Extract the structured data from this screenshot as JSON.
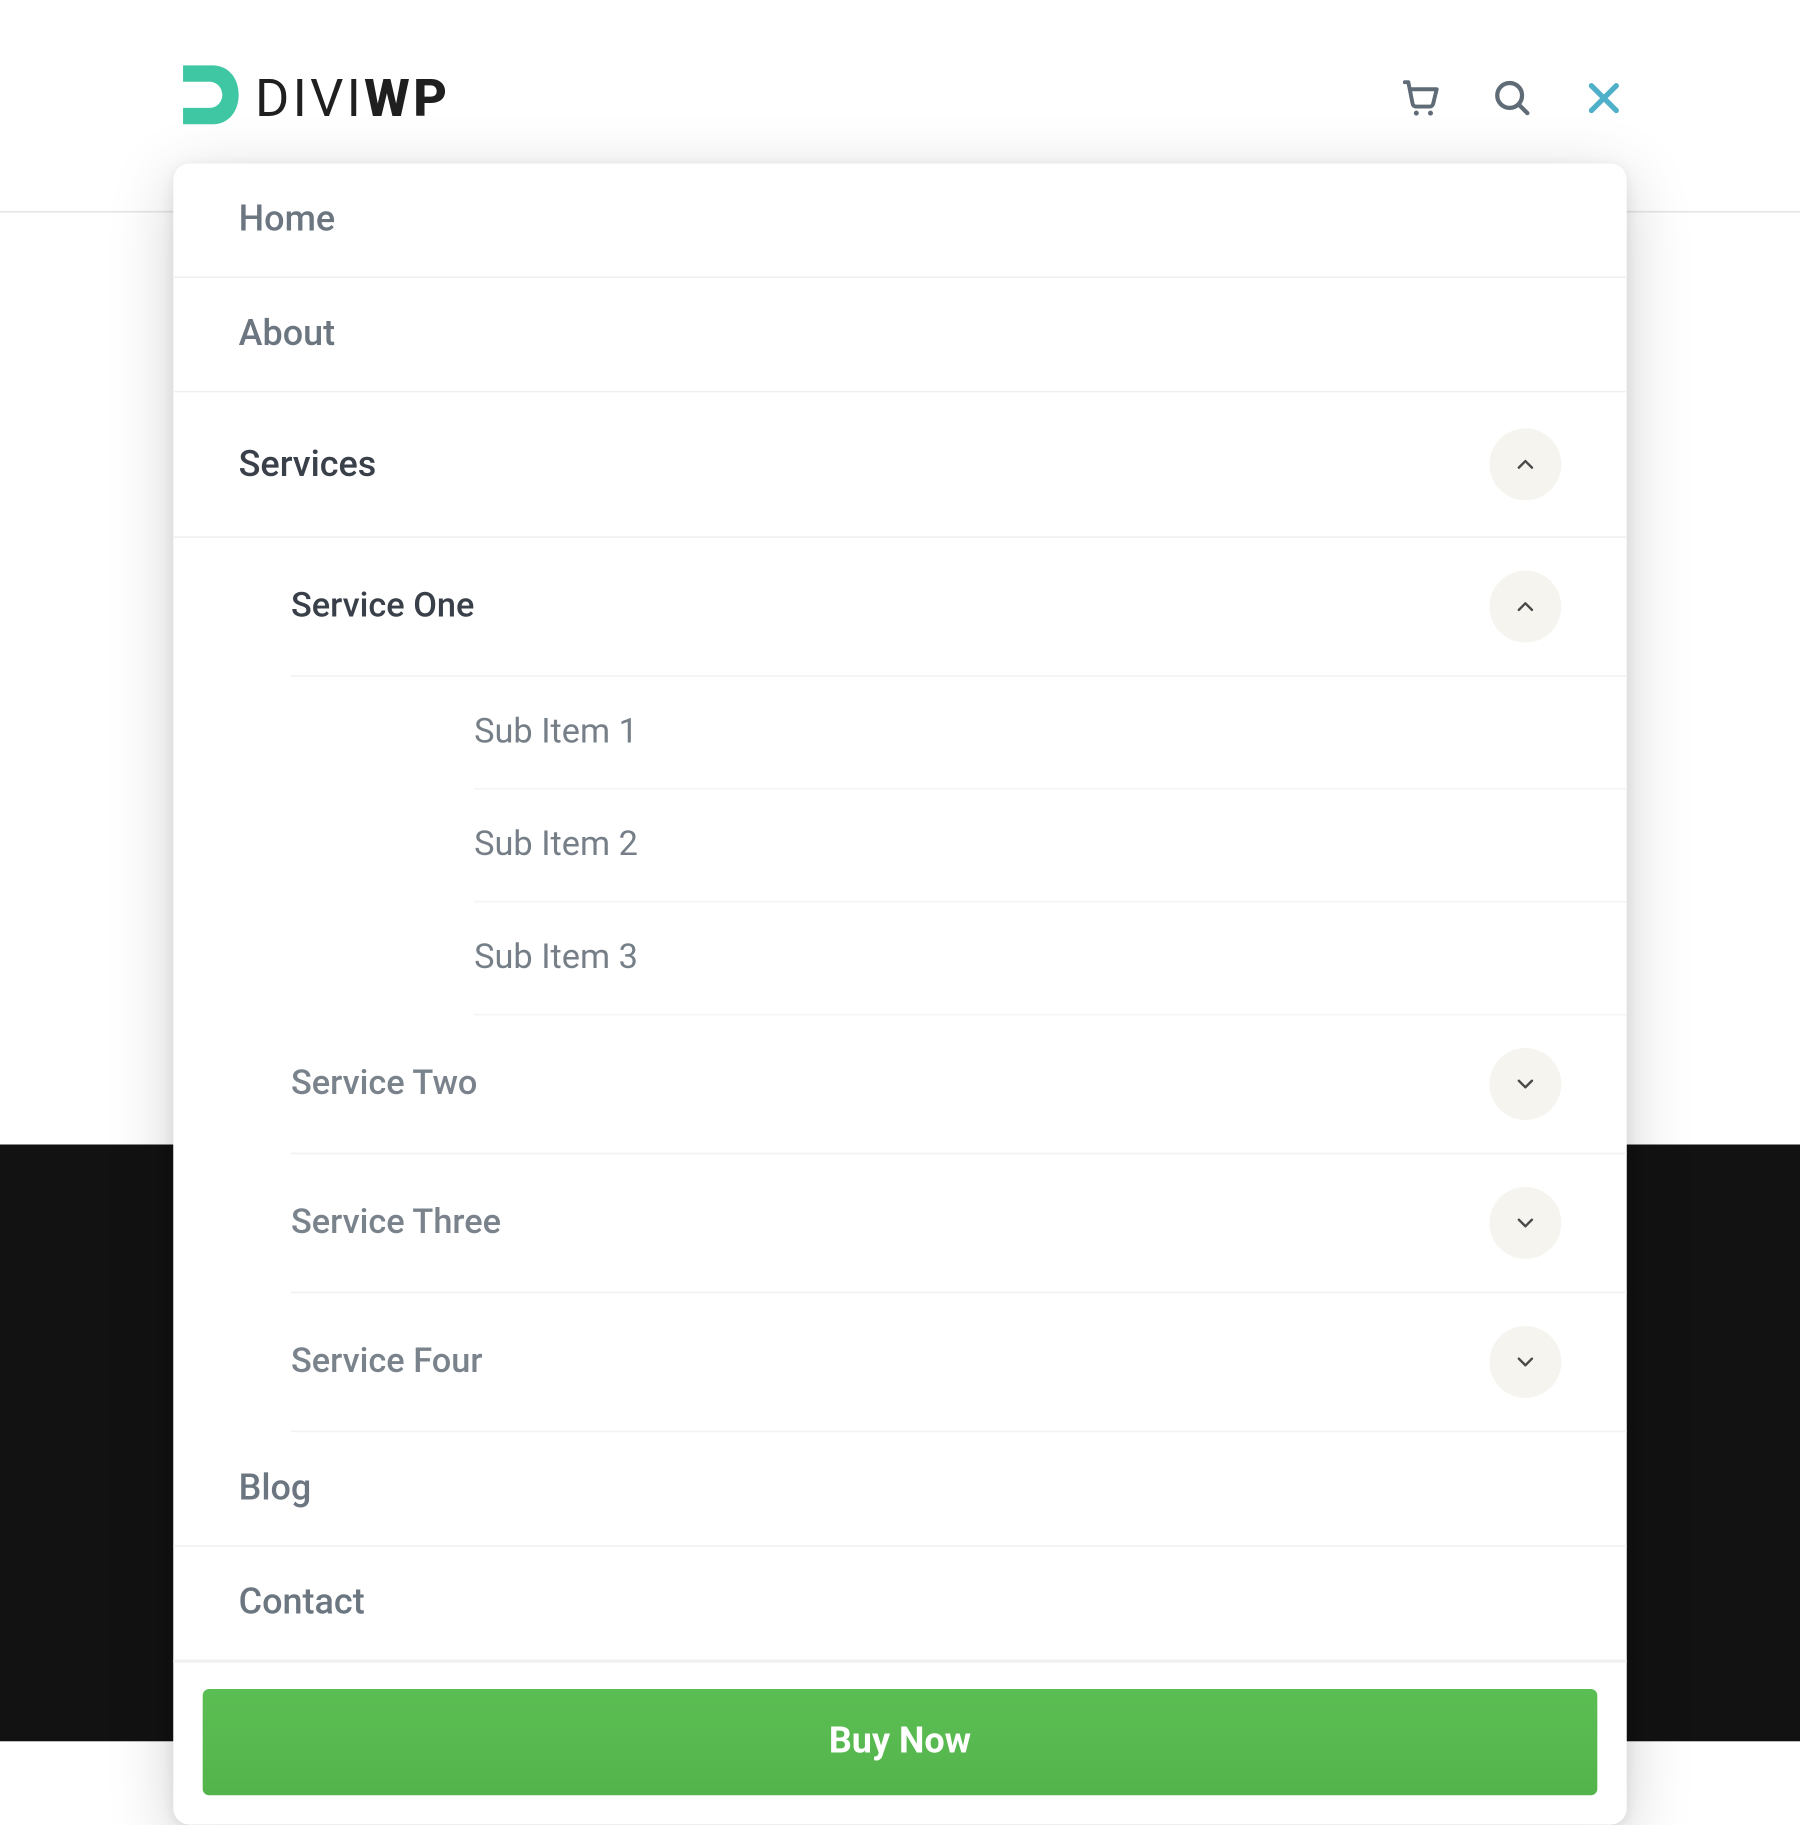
{
  "header": {
    "logo_text_light": "DIVI",
    "logo_text_bold": "WP"
  },
  "menu": {
    "home": "Home",
    "about": "About",
    "services": "Services",
    "blog": "Blog",
    "contact": "Contact",
    "service_one": "Service One",
    "service_two": "Service Two",
    "service_three": "Service Three",
    "service_four": "Service Four",
    "sub_item_1": "Sub Item 1",
    "sub_item_2": "Sub Item 2",
    "sub_item_3": "Sub Item 3",
    "cta": "Buy Now"
  },
  "colors": {
    "accent_teal": "#3fc7a4",
    "close_blue": "#4fb0c9",
    "cta_green": "#55b84d",
    "dark_bg": "#121212"
  }
}
